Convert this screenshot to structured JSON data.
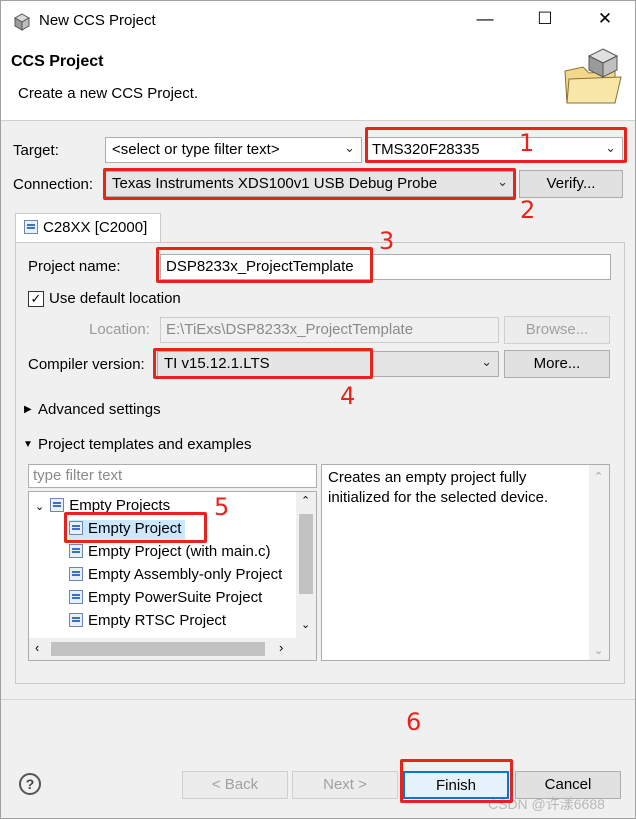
{
  "window": {
    "title": "New CCS Project",
    "minimize": "—",
    "maximize": "☐",
    "close": "✕"
  },
  "header": {
    "title": "CCS Project",
    "description": "Create a new CCS Project."
  },
  "target": {
    "label": "Target:",
    "filter_value": "<select or type filter text>",
    "device_value": "TMS320F28335"
  },
  "connection": {
    "label": "Connection:",
    "value": "Texas Instruments XDS100v1 USB Debug Probe",
    "verify_label": "Verify..."
  },
  "tab": {
    "label": "C28XX [C2000]"
  },
  "project": {
    "name_label": "Project name:",
    "name_value": "DSP8233x_ProjectTemplate",
    "use_default_label": "Use default location",
    "location_label": "Location:",
    "location_value": "E:\\TiExs\\DSP8233x_ProjectTemplate",
    "browse_label": "Browse...",
    "compiler_label": "Compiler version:",
    "compiler_value": "TI v15.12.1.LTS",
    "more_label": "More..."
  },
  "sections": {
    "advanced": "Advanced settings",
    "templates": "Project templates and examples"
  },
  "templates": {
    "filter_placeholder": "type filter text",
    "group": "Empty Projects",
    "items": [
      "Empty Project",
      "Empty Project (with main.c)",
      "Empty Assembly-only Project",
      "Empty PowerSuite Project",
      "Empty RTSC Project"
    ],
    "description": "Creates an empty project fully initialized for the selected device."
  },
  "footer": {
    "help": "?",
    "back": "< Back",
    "next": "Next >",
    "finish": "Finish",
    "cancel": "Cancel",
    "watermark": "CSDN @许漾6688"
  },
  "annotations": [
    "1",
    "2",
    "3",
    "4",
    "5",
    "6"
  ],
  "colors": {
    "annotation_red": "#e8231b",
    "selection": "#cce8ff"
  }
}
